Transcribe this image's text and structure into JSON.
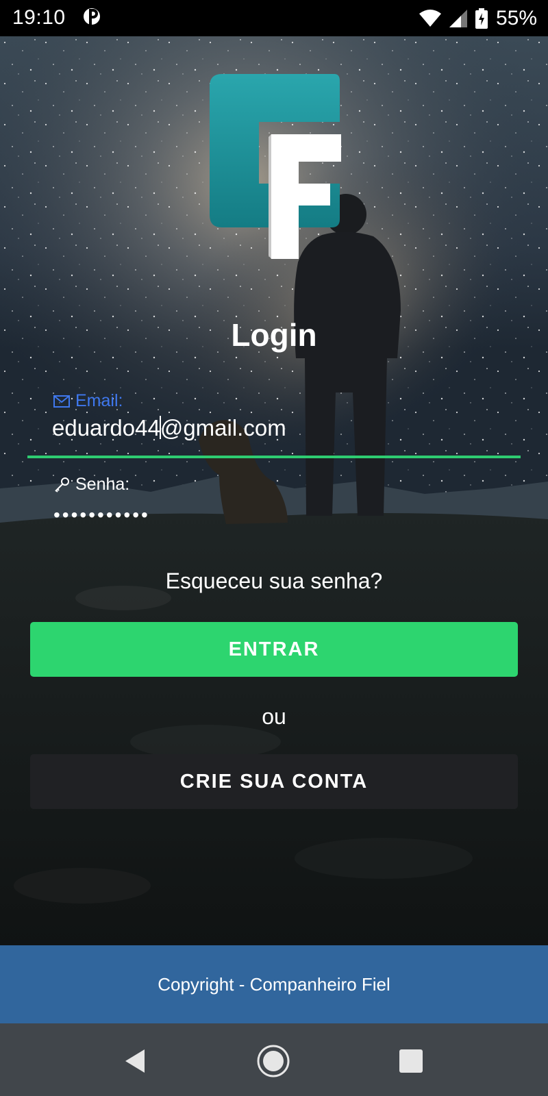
{
  "status_bar": {
    "time": "19:10",
    "battery_percent": "55%",
    "notification_icon": "p-icon",
    "wifi_icon": "wifi-icon",
    "signal_icon": "cell-signal-icon",
    "battery_icon": "battery-charging-icon"
  },
  "logo": {
    "name": "cf-logo",
    "letters": "CF",
    "colors": {
      "c": "#1a8f97",
      "f": "#ffffff"
    }
  },
  "title": "Login",
  "email": {
    "label": "Email:",
    "value_before_caret": "eduardo44",
    "value_after_caret": "@gmail.com",
    "icon": "envelope-icon"
  },
  "password": {
    "label": "Senha:",
    "value": "•••••••••••",
    "icon": "key-icon"
  },
  "forgot_password": "Esqueceu sua senha?",
  "enter_button": "ENTRAR",
  "or_text": "ou",
  "create_account_button": "CRIE SUA CONTA",
  "footer": {
    "text": "Copyright - Companheiro Fiel"
  },
  "nav": {
    "back_icon": "back-triangle-icon",
    "home_icon": "home-circle-icon",
    "recents_icon": "recents-square-icon"
  },
  "colors": {
    "accent_green": "#2dd56f",
    "focus_label_blue": "#3f78ee",
    "dark_button": "#202124",
    "footer_blue": "#31669d",
    "nav_bar": "#41464b"
  }
}
